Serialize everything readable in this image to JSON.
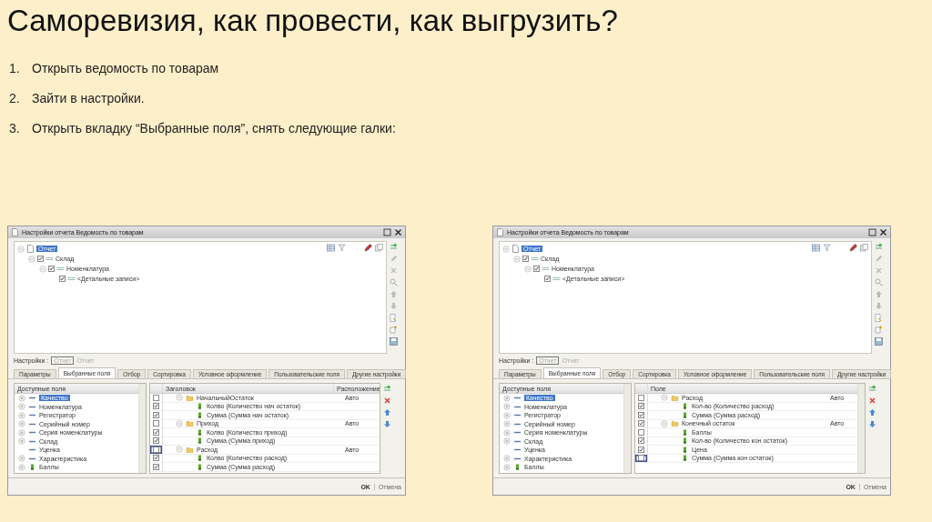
{
  "title": "Саморевизия, как провести, как выгрузить?",
  "steps": [
    {
      "number": "1.",
      "text": "Открыть ведомость по товарам"
    },
    {
      "number": "2.",
      "text": "Зайти в настройки."
    },
    {
      "number": "3.",
      "text": "Открыть вкладку “Выбранные поля”, снять следующие галки:"
    }
  ],
  "windows": [
    {
      "title": "Настройки отчета  Ведомость по товарам",
      "tree": [
        {
          "label": "Отчет",
          "kind": "report",
          "selected": true,
          "children": [
            {
              "label": "Склад",
              "kind": "grouping",
              "checked": true,
              "selected": false,
              "children": [
                {
                  "label": "Номенклатура",
                  "kind": "grouping",
                  "checked": true,
                  "selected": false,
                  "children": [
                    {
                      "label": "<Детальные записи>",
                      "kind": "grouping",
                      "checked": true,
                      "selected": false
                    }
                  ]
                }
              ]
            }
          ]
        }
      ],
      "settings_label": "Настройки :",
      "settings_values": [
        "Отчет",
        "Отчет"
      ],
      "tabs": [
        {
          "label": "Параметры",
          "selected": false
        },
        {
          "label": "Выбранные поля",
          "selected": true
        },
        {
          "label": "Отбор",
          "selected": false
        },
        {
          "label": "Сортировка",
          "selected": false
        },
        {
          "label": "Условное оформление",
          "selected": false
        },
        {
          "label": "Пользовательские поля",
          "selected": false
        },
        {
          "label": "Другие настройки",
          "selected": false
        }
      ],
      "available_fields": {
        "header": "Доступные поля",
        "items": [
          {
            "label": "Качество",
            "kind": "field",
            "expandable": true,
            "selected": true
          },
          {
            "label": "Номенклатура",
            "kind": "field",
            "expandable": true,
            "selected": false
          },
          {
            "label": "Регистратор",
            "kind": "field",
            "expandable": true,
            "selected": false
          },
          {
            "label": "Серийный номер",
            "kind": "field",
            "expandable": true,
            "selected": false
          },
          {
            "label": "Серия номенклатуры",
            "kind": "field",
            "expandable": true,
            "selected": false
          },
          {
            "label": "Склад",
            "kind": "field",
            "expandable": true,
            "selected": false
          },
          {
            "label": "Уценка",
            "kind": "field",
            "expandable": false,
            "selected": false
          },
          {
            "label": "Характеристика",
            "kind": "field",
            "expandable": true,
            "selected": false
          },
          {
            "label": "Баллы",
            "kind": "resource",
            "expandable": true,
            "selected": false
          }
        ]
      },
      "selected_fields": {
        "columns": [
          "Заголовок",
          "Расположение"
        ],
        "rows": [
          {
            "label": "НачальныйОстаток",
            "placement": "Авто",
            "checked": false,
            "focused": false,
            "children": [
              {
                "label": "Колво (Количество нач остаток)",
                "checked": true,
                "focused": false
              },
              {
                "label": "Сумма (Сумма нач остаток)",
                "checked": true,
                "focused": false
              }
            ]
          },
          {
            "label": "Приход",
            "placement": "Авто",
            "checked": false,
            "focused": false,
            "children": [
              {
                "label": "Колво (Количество приход)",
                "checked": true,
                "focused": false
              },
              {
                "label": "Сумма (Сумма приход)",
                "checked": true,
                "focused": false
              }
            ]
          },
          {
            "label": "Расход",
            "placement": "Авто",
            "checked": false,
            "focused": true,
            "children": [
              {
                "label": "Колво (Количество расход)",
                "checked": true,
                "focused": false
              },
              {
                "label": "Сумма (Сумма расход)",
                "checked": true,
                "focused": false
              }
            ]
          }
        ]
      },
      "buttons": [
        "OK",
        "Отмена"
      ]
    },
    {
      "title": "Настройки отчета  Ведомость по товарам",
      "tree": [
        {
          "label": "Отчет",
          "kind": "report",
          "selected": true,
          "children": [
            {
              "label": "Склад",
              "kind": "grouping",
              "checked": true,
              "selected": false,
              "children": [
                {
                  "label": "Номенклатура",
                  "kind": "grouping",
                  "checked": true,
                  "selected": false,
                  "children": [
                    {
                      "label": "<Детальные записи>",
                      "kind": "grouping",
                      "checked": true,
                      "selected": false
                    }
                  ]
                }
              ]
            }
          ]
        }
      ],
      "settings_label": "Настройки :",
      "settings_values": [
        "Отчет",
        "Отчет"
      ],
      "tabs": [
        {
          "label": "Параметры",
          "selected": false
        },
        {
          "label": "Выбранные поля",
          "selected": true
        },
        {
          "label": "Отбор",
          "selected": false
        },
        {
          "label": "Сортировка",
          "selected": false
        },
        {
          "label": "Условное оформление",
          "selected": false
        },
        {
          "label": "Пользовательские поля",
          "selected": false
        },
        {
          "label": "Другие настройки",
          "selected": false
        }
      ],
      "available_fields": {
        "header": "Доступные поля",
        "items": [
          {
            "label": "Качество",
            "kind": "field",
            "expandable": true,
            "selected": true
          },
          {
            "label": "Номенклатура",
            "kind": "field",
            "expandable": true,
            "selected": false
          },
          {
            "label": "Регистратор",
            "kind": "field",
            "expandable": true,
            "selected": false
          },
          {
            "label": "Серийный номер",
            "kind": "field",
            "expandable": true,
            "selected": false
          },
          {
            "label": "Серия номенклатуры",
            "kind": "field",
            "expandable": true,
            "selected": false
          },
          {
            "label": "Склад",
            "kind": "field",
            "expandable": true,
            "selected": false
          },
          {
            "label": "Уценка",
            "kind": "field",
            "expandable": false,
            "selected": false
          },
          {
            "label": "Характеристика",
            "kind": "field",
            "expandable": true,
            "selected": false
          },
          {
            "label": "Баллы",
            "kind": "resource",
            "expandable": true,
            "selected": false
          }
        ]
      },
      "selected_fields": {
        "columns": [
          "Поле"
        ],
        "rows": [
          {
            "label": "Расход",
            "placement": "Авто",
            "checked": false,
            "focused": false,
            "children": [
              {
                "label": "Кол-во (Количество расход)",
                "checked": true,
                "focused": false
              },
              {
                "label": "Сумма (Сумма расход)",
                "checked": true,
                "focused": false
              }
            ]
          },
          {
            "label": "Конечный остаток",
            "placement": "Авто",
            "checked": true,
            "focused": false,
            "children": [
              {
                "label": "Баллы",
                "checked": false,
                "focused": false
              },
              {
                "label": "Кол-во (Количество кон остаток)",
                "checked": true,
                "focused": false
              },
              {
                "label": "Цена",
                "checked": true,
                "focused": false
              },
              {
                "label": "Сумма (Сумма кон остаток)",
                "checked": false,
                "focused": true
              }
            ]
          }
        ]
      },
      "buttons": [
        "OK",
        "Отмена"
      ]
    }
  ]
}
